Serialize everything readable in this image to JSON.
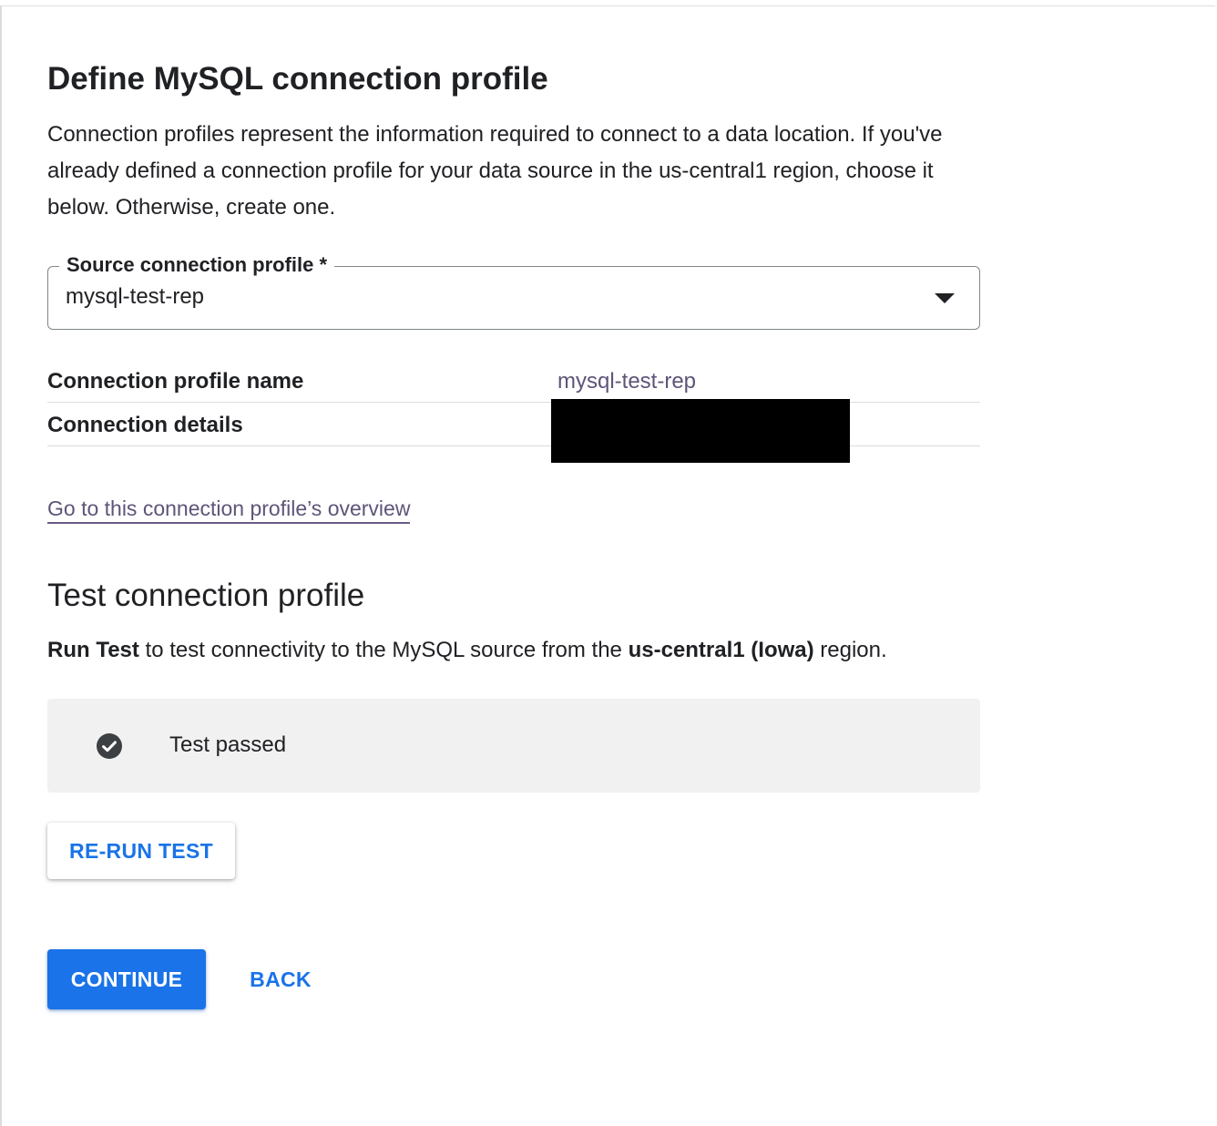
{
  "header": {
    "title": "Define MySQL connection profile",
    "description": "Connection profiles represent the information required to connect to a data location. If you've already defined a connection profile for your data source in the us-central1 region, choose it below. Otherwise, create one."
  },
  "source_select": {
    "label": "Source connection profile",
    "required_marker": "*",
    "value": "mysql-test-rep"
  },
  "details": {
    "rows": [
      {
        "label": "Connection profile name",
        "value": "mysql-test-rep"
      },
      {
        "label": "Connection details",
        "value": ""
      }
    ],
    "overview_link": "Go to this connection profile’s overview"
  },
  "test_section": {
    "title": "Test connection profile",
    "desc_part1": "Run Test",
    "desc_part2": " to test connectivity to the MySQL source from the ",
    "desc_part3": "us-central1 (Iowa)",
    "desc_part4": " region.",
    "result_icon": "check-circle-icon",
    "result_text": "Test passed",
    "rerun_label": "RE-RUN TEST"
  },
  "footer": {
    "continue_label": "CONTINUE",
    "back_label": "BACK"
  },
  "colors": {
    "primary": "#1a73e8",
    "link": "#5f5478",
    "result_bg": "#f1f1f1"
  }
}
